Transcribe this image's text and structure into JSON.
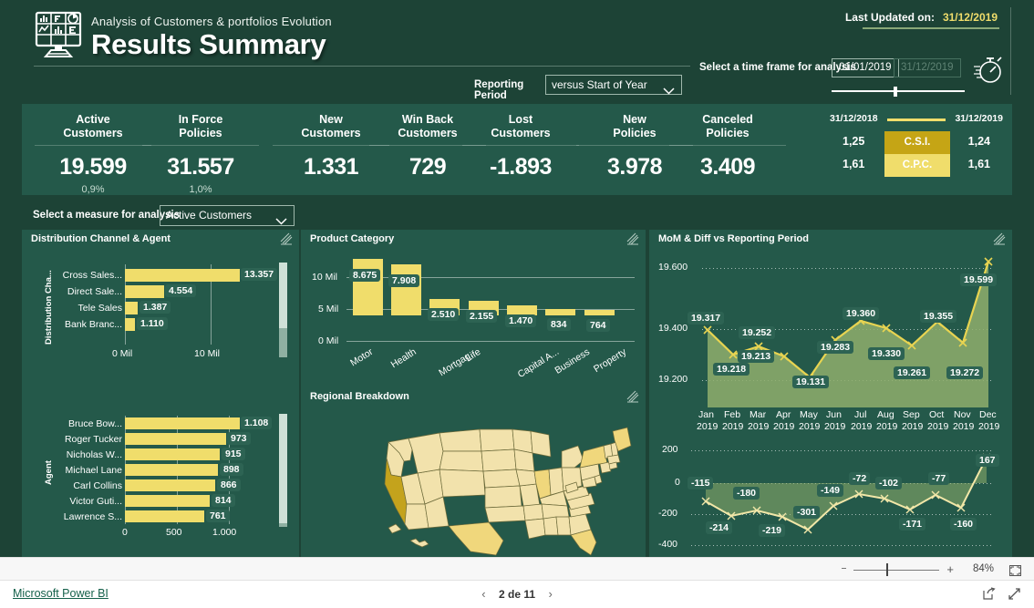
{
  "header": {
    "subtitle": "Analysis of Customers & portfolios Evolution",
    "title": "Results Summary",
    "logo_icon": "dashboard-monitor-icon",
    "last_updated_label": "Last Updated on:",
    "last_updated_value": "31/12/2019",
    "timeframe_label": "Select a time frame for analysis",
    "timeframe_start": "01/01/2019",
    "timeframe_end": "31/12/2019",
    "clock_icon": "stopwatch-icon",
    "reporting_period_label": "Reporting Period",
    "reporting_period_value": "versus Start of Year",
    "chevron_icon": "chevron-down-icon"
  },
  "kpis": [
    {
      "title_l1": "Active",
      "title_l2": "Customers",
      "value": "19.599",
      "sub": "0,9%"
    },
    {
      "title_l1": "In Force",
      "title_l2": "Policies",
      "value": "31.557",
      "sub": "1,0%"
    },
    {
      "title_l1": "New",
      "title_l2": "Customers",
      "value": "1.331",
      "sub": ""
    },
    {
      "title_l1": "Win Back",
      "title_l2": "Customers",
      "value": "729",
      "sub": ""
    },
    {
      "title_l1": "Lost",
      "title_l2": "Customers",
      "value": "-1.893",
      "sub": ""
    },
    {
      "title_l1": "New",
      "title_l2": "Policies",
      "value": "3.978",
      "sub": ""
    },
    {
      "title_l1": "Canceled",
      "title_l2": "Policies",
      "value": "3.409",
      "sub": ""
    }
  ],
  "kpi_right": {
    "date_left": "31/12/2018",
    "date_right": "31/12/2019",
    "rows": [
      {
        "label": "C.S.I.",
        "left": "1,25",
        "right": "1,24",
        "color": "#c5a515"
      },
      {
        "label": "C.P.C.",
        "left": "1,61",
        "right": "1,61",
        "color": "#f0dd6b"
      }
    ]
  },
  "measure_selector": {
    "label": "Select a measure for analysis",
    "value": "Active Customers",
    "chevron_icon": "chevron-down-icon"
  },
  "cards": {
    "distribution": {
      "title": "Distribution Channel & Agent",
      "focus_icon": "focus-mode-icon"
    },
    "product": {
      "title": "Product Category",
      "focus_icon": "focus-mode-icon"
    },
    "regional": {
      "title": "Regional Breakdown",
      "focus_icon": "focus-mode-icon"
    },
    "mom": {
      "title": "MoM & Diff vs Reporting Period",
      "focus_icon": "focus-mode-icon"
    }
  },
  "chart_data": [
    {
      "type": "bar",
      "orientation": "horizontal",
      "title": "Distribution Channel",
      "ylabel": "Distribution Cha...",
      "xlabel": "",
      "categories": [
        "Cross Sales...",
        "Direct Sale...",
        "Tele Sales",
        "Bank Branc..."
      ],
      "values": [
        13357,
        4554,
        1387,
        1110
      ],
      "labels": [
        "13.357",
        "4.554",
        "1.387",
        "1.110"
      ],
      "xticks": [
        "0 Mil",
        "10 Mil"
      ],
      "xlim": [
        0,
        15000
      ],
      "grid": true
    },
    {
      "type": "bar",
      "orientation": "horizontal",
      "title": "Agent",
      "ylabel": "Agent",
      "xlabel": "",
      "categories": [
        "Bruce Bow...",
        "Roger Tucker",
        "Nicholas W...",
        "Michael Lane",
        "Carl Collins",
        "Victor Guti...",
        "Lawrence S..."
      ],
      "values": [
        1108,
        973,
        915,
        898,
        866,
        814,
        761
      ],
      "labels": [
        "1.108",
        "973",
        "915",
        "898",
        "866",
        "814",
        "761"
      ],
      "xticks": [
        "0",
        "500",
        "1.000"
      ],
      "xlim": [
        0,
        1250
      ],
      "grid": true
    },
    {
      "type": "bar",
      "orientation": "vertical",
      "title": "Product Category",
      "categories": [
        "Motor",
        "Health",
        "Mortgag...",
        "Life",
        "Capital A...",
        "Business",
        "Property"
      ],
      "values": [
        8675,
        7908,
        2510,
        2155,
        1470,
        834,
        764
      ],
      "labels": [
        "8.675",
        "7.908",
        "2.510",
        "2.155",
        "1.470",
        "834",
        "764"
      ],
      "yticks": [
        "0 Mil",
        "5 Mil",
        "10 Mil"
      ],
      "ylim": [
        0,
        11000
      ],
      "grid": true
    },
    {
      "type": "area",
      "title": "MoM",
      "categories": [
        "Jan\n2019",
        "Feb\n2019",
        "Mar\n2019",
        "Apr\n2019",
        "May\n2019",
        "Jun\n2019",
        "Jul\n2019",
        "Aug\n2019",
        "Sep\n2019",
        "Oct\n2019",
        "Nov\n2019",
        "Dec\n2019"
      ],
      "x_l1": [
        "Jan",
        "Feb",
        "Mar",
        "Apr",
        "May",
        "Jun",
        "Jul",
        "Aug",
        "Sep",
        "Oct",
        "Nov",
        "Dec"
      ],
      "x_l2": [
        "2019",
        "2019",
        "2019",
        "2019",
        "2019",
        "2019",
        "2019",
        "2019",
        "2019",
        "2019",
        "2019",
        "2019"
      ],
      "values": [
        19317,
        19218,
        19252,
        19213,
        19131,
        19283,
        19360,
        19330,
        19261,
        19355,
        19272,
        19599
      ],
      "labels": [
        "19.317",
        "19.218",
        "19.252",
        "19.213",
        "19.131",
        "19.283",
        "19.360",
        "19.330",
        "19.261",
        "19.355",
        "19.272",
        "19.599"
      ],
      "yticks": [
        "19.200",
        "19.400",
        "19.600"
      ],
      "ylim": [
        19080,
        19650
      ],
      "grid": true,
      "line_color": "#f0dd6b"
    },
    {
      "type": "area",
      "title": "Diff vs Reporting Period",
      "categories": [
        "Jan",
        "Feb",
        "Mar",
        "Apr",
        "May",
        "Jun",
        "Jul",
        "Aug",
        "Sep",
        "Oct",
        "Nov",
        "Dec"
      ],
      "values": [
        -115,
        -214,
        -180,
        -219,
        -301,
        -149,
        -72,
        -102,
        -171,
        -77,
        -160,
        167
      ],
      "labels": [
        "-115",
        "-214",
        "-180",
        "-219",
        "-301",
        "-149",
        "-72",
        "-102",
        "-171",
        "-77",
        "-160",
        "167"
      ],
      "yticks": [
        "-400",
        "-200",
        "0",
        "200"
      ],
      "ylim": [
        -400,
        250
      ],
      "grid": true,
      "line_color": "#f2e7a8"
    }
  ],
  "map": {
    "title": "Regional Breakdown",
    "highlights": [
      "California",
      "Texas",
      "Florida",
      "Illinois"
    ]
  },
  "zoombar": {
    "percent": "84%",
    "minus_icon": "zoom-out-icon",
    "plus_icon": "zoom-in-icon",
    "fit_icon": "fit-to-page-icon"
  },
  "statusbar": {
    "brand": "Microsoft Power BI",
    "prev_icon": "chevron-left-icon",
    "page": "2 de 11",
    "next_icon": "chevron-right-icon",
    "share_icon": "share-icon",
    "fullscreen_icon": "fullscreen-icon"
  },
  "colors": {
    "background": "#1d4336",
    "panel": "#24594a",
    "accent": "#f0dd6b",
    "accent_dark": "#c5a515",
    "text": "#ffffff"
  }
}
